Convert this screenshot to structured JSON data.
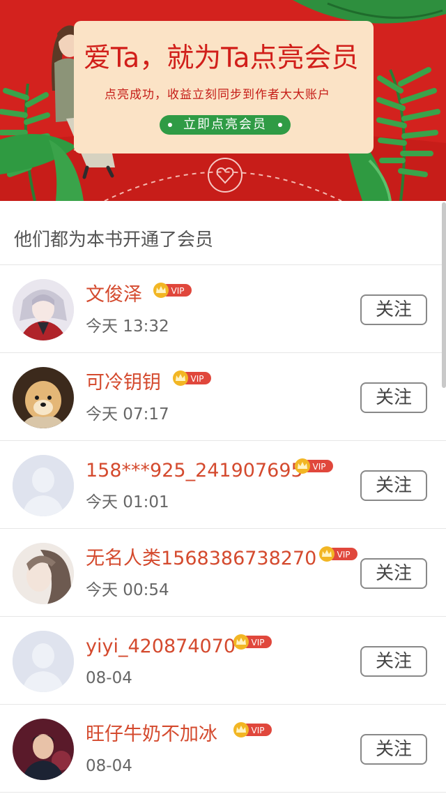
{
  "banner": {
    "title": "爱Ta，就为Ta点亮会员",
    "subtitle": "点亮成功，收益立刻同步到作者大大账户",
    "cta_label": "立即点亮会员"
  },
  "section": {
    "title": "他们都为本书开通了会员"
  },
  "vip_label": "VIP",
  "follow_label": "关注",
  "members": [
    {
      "name": "文俊泽",
      "time": "今天 13:32",
      "avatar": "anime-avatar-icon"
    },
    {
      "name": "可冷钥钥",
      "time": "今天 07:17",
      "avatar": "dog-avatar-icon"
    },
    {
      "name": "158***925_241907695",
      "time": "今天 01:01",
      "avatar": "default-avatar-icon"
    },
    {
      "name": "无名人类1568386738270",
      "time": "今天 00:54",
      "avatar": "girl-avatar-icon"
    },
    {
      "name": "yiyi_420874070",
      "time": "08-04",
      "avatar": "default-avatar-icon"
    },
    {
      "name": "旺仔牛奶不加冰",
      "time": "08-04",
      "avatar": "boy-avatar-icon"
    }
  ],
  "colors": {
    "banner_red": "#d3221e",
    "card_cream": "#fbe3c6",
    "cta_green": "#2f9b45",
    "name_orange": "#d44a2e",
    "vip_red": "#e0473c",
    "crown_gold": "#f2b624"
  }
}
